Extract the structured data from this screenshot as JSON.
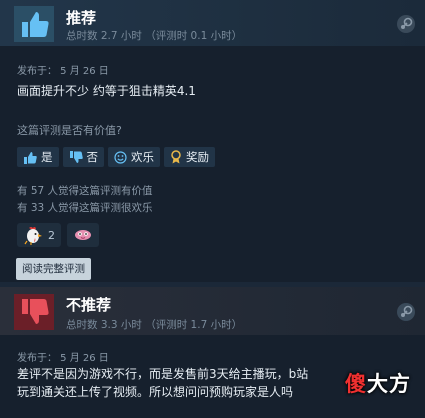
{
  "review1": {
    "verdict": "推荐",
    "hours": "总时数 2.7 小时 （评测时 0.1 小时）",
    "date": "发布于：  5 月 26 日",
    "content": "画面提升不少 约等于狙击精英4.1",
    "helpful_question": "这篇评测是否有价值?",
    "buttons": {
      "yes": "是",
      "no": "否",
      "funny": "欢乐",
      "award": "奖励"
    },
    "helpful_count": "有 57 人觉得这篇评测有价值",
    "funny_count": "有 33 人觉得这篇评测很欢乐",
    "awards": [
      {
        "icon": "rooster-icon",
        "count": "2"
      },
      {
        "icon": "pink-face-icon",
        "count": ""
      }
    ],
    "read_more": "阅读完整评测"
  },
  "review2": {
    "verdict": "不推荐",
    "hours": "总时数 3.3 小时 （评测时 1.7 小时）",
    "date": "发布于：  5 月 26 日",
    "content_line1": "差评不是因为游戏不行，而是发售前3天给主播玩，b站",
    "content_line2": "玩到通关还上传了视频。所以想问问预购玩家是人吗"
  },
  "watermark": {
    "part1": "傻",
    "part2": "大方"
  },
  "colors": {
    "background": "#1b2838",
    "card": "#16202d",
    "thumb_up": "#66c0f4",
    "thumb_down": "#d94a55"
  }
}
